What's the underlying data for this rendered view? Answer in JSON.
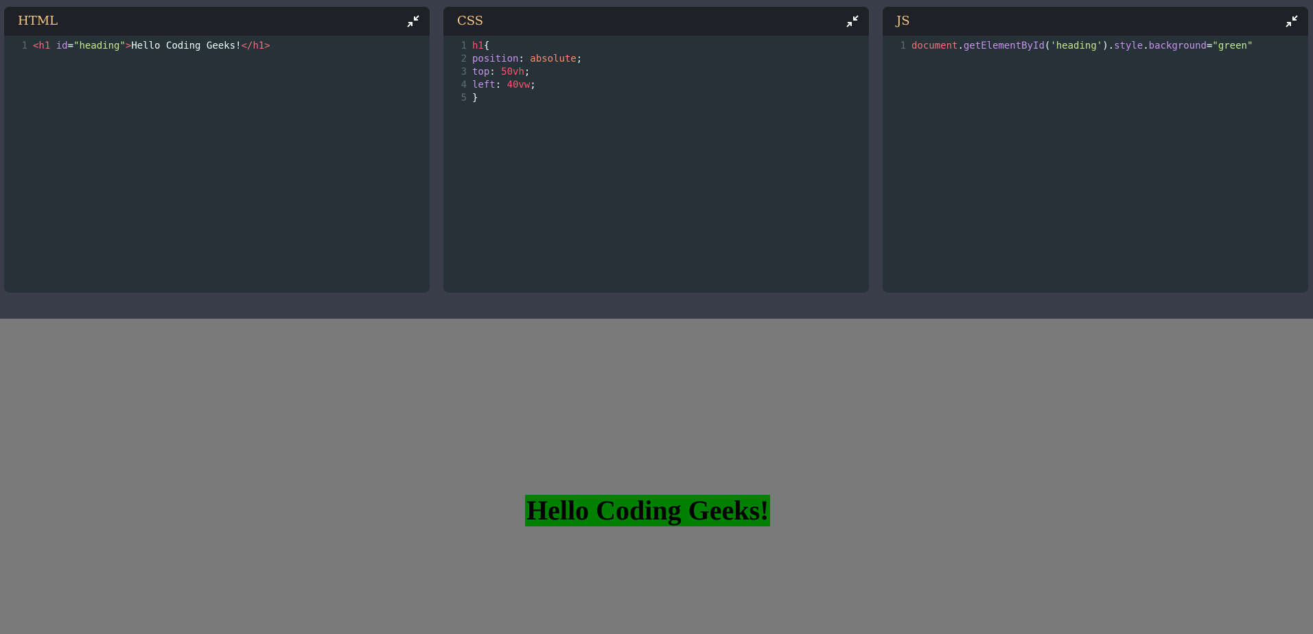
{
  "editors": [
    {
      "title": "HTML",
      "collapse_icon": "collapse-icon",
      "lines": [
        {
          "num": "1",
          "tokens": [
            {
              "t": "<h1 ",
              "c": "tag"
            },
            {
              "t": "id",
              "c": "attr"
            },
            {
              "t": "=",
              "c": "text"
            },
            {
              "t": "\"heading\"",
              "c": "str"
            },
            {
              "t": ">",
              "c": "tag"
            },
            {
              "t": "Hello Coding Geeks!",
              "c": "text"
            },
            {
              "t": "</h1>",
              "c": "tag"
            }
          ]
        }
      ]
    },
    {
      "title": "CSS",
      "collapse_icon": "collapse-icon",
      "lines": [
        {
          "num": "1",
          "tokens": [
            {
              "t": "h1",
              "c": "sel"
            },
            {
              "t": "{",
              "c": "punc"
            }
          ]
        },
        {
          "num": "2",
          "tokens": [
            {
              "t": "position",
              "c": "prop"
            },
            {
              "t": ": ",
              "c": "punc"
            },
            {
              "t": "absolute",
              "c": "val"
            },
            {
              "t": ";",
              "c": "punc"
            }
          ]
        },
        {
          "num": "3",
          "tokens": [
            {
              "t": "top",
              "c": "prop"
            },
            {
              "t": ": ",
              "c": "punc"
            },
            {
              "t": "50vh",
              "c": "num"
            },
            {
              "t": ";",
              "c": "punc"
            }
          ]
        },
        {
          "num": "4",
          "tokens": [
            {
              "t": "left",
              "c": "prop"
            },
            {
              "t": ": ",
              "c": "punc"
            },
            {
              "t": "40vw",
              "c": "num"
            },
            {
              "t": ";",
              "c": "punc"
            }
          ]
        },
        {
          "num": "5",
          "tokens": [
            {
              "t": "}",
              "c": "punc"
            }
          ]
        }
      ]
    },
    {
      "title": "JS",
      "collapse_icon": "collapse-icon",
      "lines": [
        {
          "num": "1",
          "tokens": [
            {
              "t": "document",
              "c": "obj"
            },
            {
              "t": ".",
              "c": "punc"
            },
            {
              "t": "getElementById",
              "c": "fn"
            },
            {
              "t": "(",
              "c": "punc"
            },
            {
              "t": "'heading'",
              "c": "str"
            },
            {
              "t": ")",
              "c": "punc"
            },
            {
              "t": ".",
              "c": "punc"
            },
            {
              "t": "style",
              "c": "fn"
            },
            {
              "t": ".",
              "c": "punc"
            },
            {
              "t": "background",
              "c": "fn"
            },
            {
              "t": "=",
              "c": "punc"
            },
            {
              "t": "\"green\"",
              "c": "str"
            }
          ]
        }
      ]
    }
  ],
  "preview": {
    "heading": "Hello Coding Geeks!",
    "heading_background": "#008000"
  },
  "colors": {
    "editor_area_bg": "#393e4a",
    "panel_bg": "#263238",
    "panel_header_bg": "#1f2126",
    "title_color": "#f6c987",
    "preview_bg": "#7a7a7a"
  }
}
